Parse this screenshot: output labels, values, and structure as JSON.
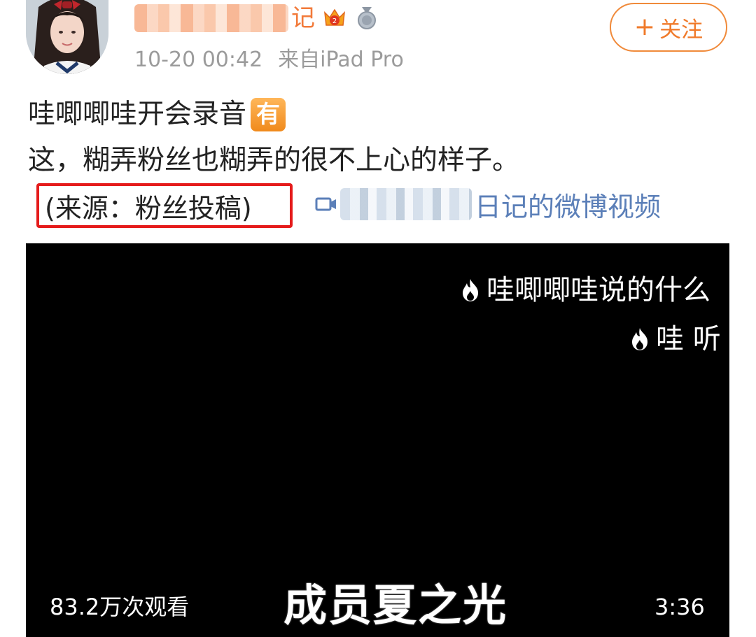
{
  "author": {
    "name_visible_suffix": "记",
    "badges": [
      "crown-level-icon",
      "silver-medal-icon"
    ],
    "timestamp": "10-20 00:42",
    "source": "来自iPad Pro",
    "follow_label": "关注",
    "follow_icon": "plus-icon"
  },
  "post": {
    "line1": "哇唧唧哇开会录音",
    "line1_emoji_label": "有",
    "line2": "这，糊弄粉丝也糊弄的很不上心的样子。",
    "source_note": "(来源：粉丝投稿)",
    "video_link_text": "日记的微博视频",
    "video_link_icon": "video-link-icon"
  },
  "video": {
    "danmaku": [
      "哇唧唧哇说的什么",
      "哇 听"
    ],
    "view_count": "83.2万次观看",
    "subtitle": "成员夏之光",
    "duration": "3:36"
  },
  "colors": {
    "accent_orange": "#f07a2a",
    "link_blue": "#5b7fb8",
    "highlight_red": "#e51b1b",
    "meta_gray": "#9b9b9b"
  }
}
